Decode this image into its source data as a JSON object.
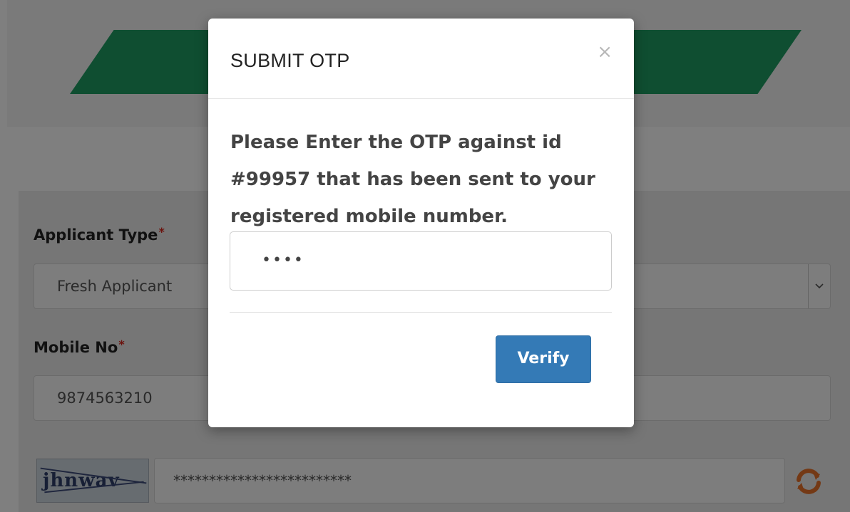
{
  "form": {
    "applicant_type_label": "Applicant Type",
    "applicant_type_required": "*",
    "applicant_type_value": "Fresh Applicant",
    "mobile_label": "Mobile No",
    "mobile_required": "*",
    "mobile_value": "9874563210",
    "captcha_text": "jhnwav",
    "captcha_input_value": "*************************"
  },
  "modal": {
    "title": "SUBMIT OTP",
    "close_symbol": "×",
    "message": "Please Enter the OTP against id #99957 that has been sent to your registered mobile number.",
    "otp_value": "••••",
    "verify_label": "Verify"
  },
  "colors": {
    "banner": "#1f9c63",
    "verify_button": "#347ab6",
    "refresh_icon": "#e8732a",
    "required_marker": "#d9261c"
  },
  "icons": {
    "close": "close-icon",
    "refresh": "refresh-icon",
    "select_arrow": "chevron-down-icon"
  }
}
